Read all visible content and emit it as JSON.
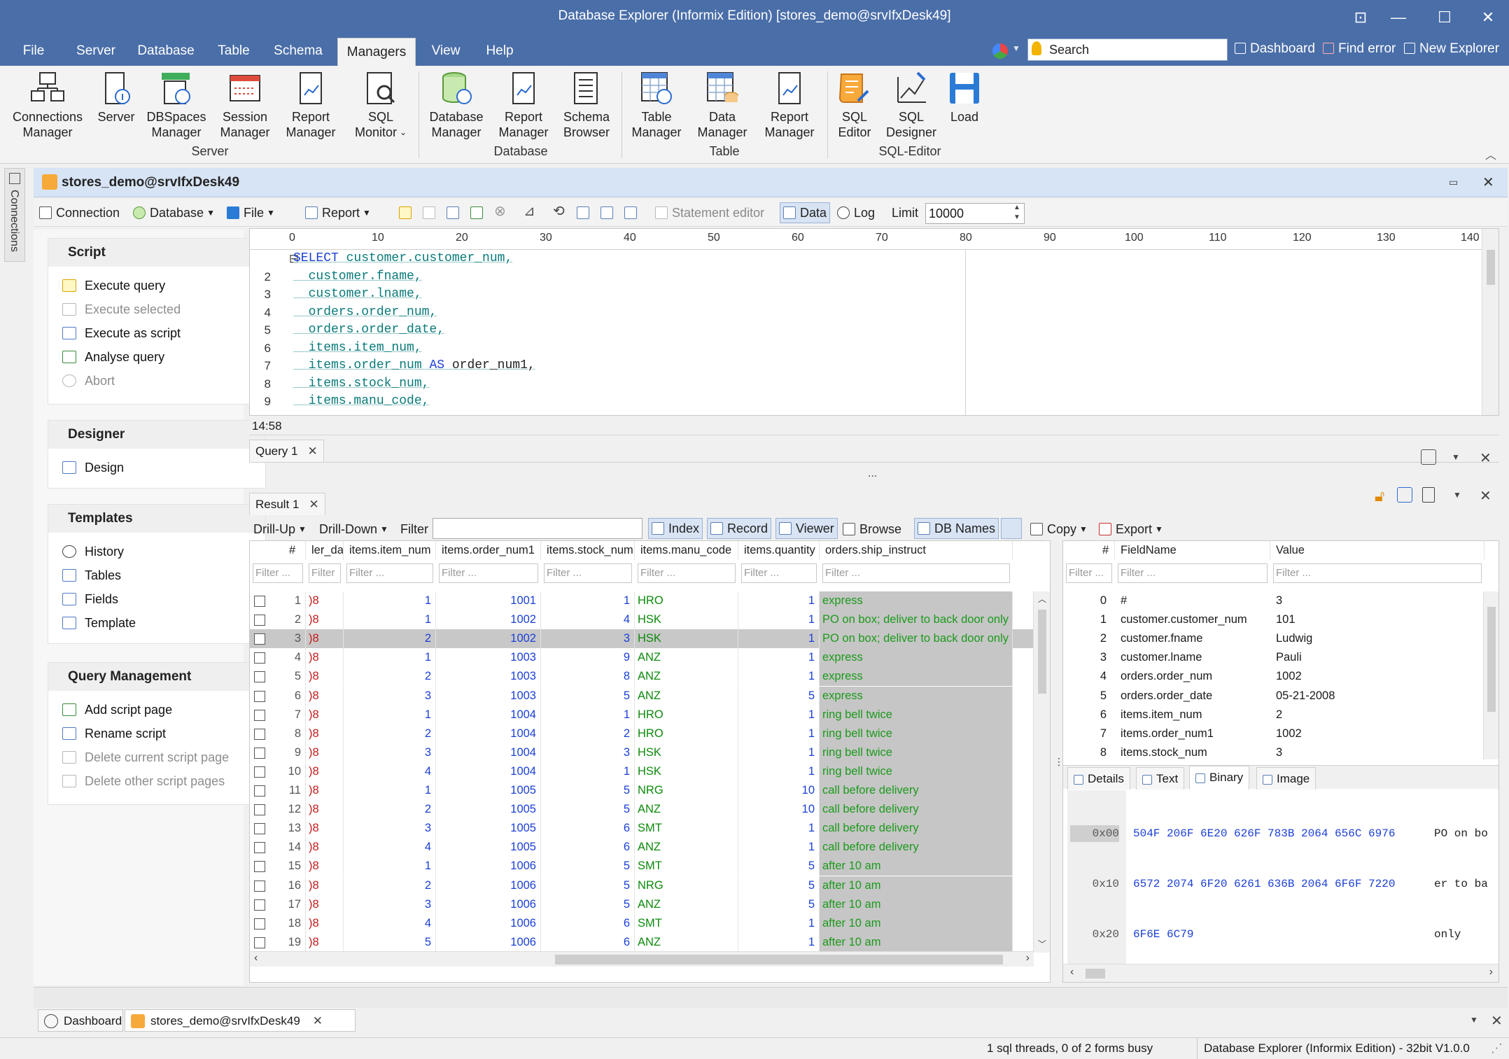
{
  "window": {
    "title": "Database Explorer (Informix Edition) [stores_demo@srvIfxDesk49]",
    "minimize": "—",
    "maximize": "☐",
    "close": "✕",
    "restore": "⊡"
  },
  "menu": {
    "items": [
      "File",
      "Server",
      "Database",
      "Table",
      "Schema",
      "Managers",
      "View",
      "Help"
    ],
    "active": "Managers",
    "search_placeholder": "Search",
    "dashboard": "Dashboard",
    "find_error": "Find error",
    "new_explorer": "New Explorer"
  },
  "ribbon": {
    "server_group": "Server",
    "database_group": "Database",
    "table_group": "Table",
    "sqleditor_group": "SQL-Editor",
    "buttons": [
      {
        "l1": "Connections",
        "l2": "Manager"
      },
      {
        "l1": "Server",
        "l2": ""
      },
      {
        "l1": "DBSpaces",
        "l2": "Manager"
      },
      {
        "l1": "Session",
        "l2": "Manager"
      },
      {
        "l1": "Report",
        "l2": "Manager"
      },
      {
        "l1": "SQL",
        "l2": "Monitor"
      },
      {
        "l1": "Database",
        "l2": "Manager"
      },
      {
        "l1": "Report",
        "l2": "Manager"
      },
      {
        "l1": "Schema",
        "l2": "Browser"
      },
      {
        "l1": "Table",
        "l2": "Manager"
      },
      {
        "l1": "Data",
        "l2": "Manager"
      },
      {
        "l1": "Report",
        "l2": "Manager"
      },
      {
        "l1": "SQL",
        "l2": "Editor"
      },
      {
        "l1": "SQL",
        "l2": "Designer"
      },
      {
        "l1": "Load",
        "l2": ""
      }
    ]
  },
  "side_tab": "Connections",
  "doc": {
    "title": "stores_demo@srvIfxDesk49"
  },
  "toolbar": {
    "connection": "Connection",
    "database": "Database",
    "file": "File",
    "report": "Report",
    "statement_editor": "Statement editor",
    "data": "Data",
    "log": "Log",
    "limit_label": "Limit",
    "limit_value": "10000"
  },
  "left": {
    "script": {
      "title": "Script",
      "items": [
        "Execute query",
        "Execute selected",
        "Execute as script",
        "Analyse query",
        "Abort"
      ]
    },
    "designer": {
      "title": "Designer",
      "items": [
        "Design"
      ]
    },
    "templates": {
      "title": "Templates",
      "items": [
        "History",
        "Tables",
        "Fields",
        "Template"
      ]
    },
    "qm": {
      "title": "Query Management",
      "items": [
        "Add script page",
        "Rename script",
        "Delete current script page",
        "Delete other script pages"
      ]
    }
  },
  "editor": {
    "ruler": [
      "0",
      "10",
      "20",
      "30",
      "40",
      "50",
      "60",
      "70",
      "80",
      "90",
      "100",
      "110",
      "120",
      "130",
      "140"
    ],
    "lines": [
      {
        "n": "",
        "kw": "SELECT",
        "t": " customer.customer_num,"
      },
      {
        "n": "2",
        "kw": "",
        "t": "  customer.fname,"
      },
      {
        "n": "3",
        "kw": "",
        "t": "  customer.lname,"
      },
      {
        "n": "4",
        "kw": "",
        "t": "  orders.order_num,"
      },
      {
        "n": "5",
        "kw": "",
        "t": "  orders.order_date,"
      },
      {
        "n": "6",
        "kw": "",
        "t": "  items.item_num,"
      },
      {
        "n": "7",
        "kw": "AS",
        "t": "  items.order_num ",
        "after": " order_num1,"
      },
      {
        "n": "8",
        "kw": "",
        "t": "  items.stock_num,"
      },
      {
        "n": "9",
        "kw": "",
        "t": "  items.manu_code,"
      }
    ],
    "cursor": "14:58",
    "collapse": "⊟"
  },
  "query_tab": "Query 1",
  "result_tab": "Result 1",
  "ellipsis": "...",
  "resulttoolbar": {
    "drill_up": "Drill-Up",
    "drill_down": "Drill-Down",
    "filter": "Filter",
    "index": "Index",
    "record": "Record",
    "viewer": "Viewer",
    "browse": "Browse",
    "db_names": "DB Names",
    "copy": "Copy",
    "export": "Export"
  },
  "grid": {
    "headers": [
      "#",
      "ler_date",
      "items.item_num",
      "items.order_num1",
      "items.stock_num",
      "items.manu_code",
      "items.quantity",
      "orders.ship_instruct"
    ],
    "filter_placeholder": "Filter ...",
    "rows": [
      [
        "1",
        ")8",
        "1",
        "1001",
        "1",
        "HRO",
        "1",
        "express"
      ],
      [
        "2",
        ")8",
        "1",
        "1002",
        "4",
        "HSK",
        "1",
        "PO on box; deliver to back door only"
      ],
      [
        "3",
        ")8",
        "2",
        "1002",
        "3",
        "HSK",
        "1",
        "PO on box; deliver to back door only"
      ],
      [
        "4",
        ")8",
        "1",
        "1003",
        "9",
        "ANZ",
        "1",
        "express"
      ],
      [
        "5",
        ")8",
        "2",
        "1003",
        "8",
        "ANZ",
        "1",
        "express"
      ],
      [
        "6",
        ")8",
        "3",
        "1003",
        "5",
        "ANZ",
        "5",
        "express"
      ],
      [
        "7",
        ")8",
        "1",
        "1004",
        "1",
        "HRO",
        "1",
        "ring bell twice"
      ],
      [
        "8",
        ")8",
        "2",
        "1004",
        "2",
        "HRO",
        "1",
        "ring bell twice"
      ],
      [
        "9",
        ")8",
        "3",
        "1004",
        "3",
        "HSK",
        "1",
        "ring bell twice"
      ],
      [
        "10",
        ")8",
        "4",
        "1004",
        "1",
        "HSK",
        "1",
        "ring bell twice"
      ],
      [
        "11",
        ")8",
        "1",
        "1005",
        "5",
        "NRG",
        "10",
        "call before delivery"
      ],
      [
        "12",
        ")8",
        "2",
        "1005",
        "5",
        "ANZ",
        "10",
        "call before delivery"
      ],
      [
        "13",
        ")8",
        "3",
        "1005",
        "6",
        "SMT",
        "1",
        "call before delivery"
      ],
      [
        "14",
        ")8",
        "4",
        "1005",
        "6",
        "ANZ",
        "1",
        "call before delivery"
      ],
      [
        "15",
        ")8",
        "1",
        "1006",
        "5",
        "SMT",
        "5",
        "after 10 am"
      ],
      [
        "16",
        ")8",
        "2",
        "1006",
        "5",
        "NRG",
        "5",
        "after 10 am"
      ],
      [
        "17",
        ")8",
        "3",
        "1006",
        "5",
        "ANZ",
        "5",
        "after 10 am"
      ],
      [
        "18",
        ")8",
        "4",
        "1006",
        "6",
        "SMT",
        "1",
        "after 10 am"
      ],
      [
        "19",
        ")8",
        "5",
        "1006",
        "6",
        "ANZ",
        "1",
        "after 10 am"
      ]
    ]
  },
  "record": {
    "headers": [
      "#",
      "FieldName",
      "Value"
    ],
    "rows": [
      [
        "0",
        "#",
        "3"
      ],
      [
        "1",
        "customer.customer_num",
        "101"
      ],
      [
        "2",
        "customer.fname",
        "Ludwig"
      ],
      [
        "3",
        "customer.lname",
        "Pauli"
      ],
      [
        "4",
        "orders.order_num",
        "1002"
      ],
      [
        "5",
        "orders.order_date",
        "05-21-2008"
      ],
      [
        "6",
        "items.item_num",
        "2"
      ],
      [
        "7",
        "items.order_num1",
        "1002"
      ],
      [
        "8",
        "items.stock_num",
        "3"
      ]
    ],
    "tabs": [
      "Details",
      "Text",
      "Binary",
      "Image"
    ],
    "hex": [
      {
        "addr": "0x00",
        "bytes": "504F 206F 6E20 626F 783B 2064 656C 6976",
        "ascii": "PO on bo"
      },
      {
        "addr": "0x10",
        "bytes": "6572 2074 6F20 6261 636B 2064 6F6F 7220",
        "ascii": "er to ba"
      },
      {
        "addr": "0x20",
        "bytes": "6F6E 6C79",
        "ascii": "only"
      }
    ]
  },
  "doctabs": {
    "dashboard": "Dashboard",
    "doc": "stores_demo@srvIfxDesk49"
  },
  "status": {
    "threads": "1 sql threads, 0 of 2 forms busy",
    "app": "Database Explorer (Informix Edition) - 32bit V1.0.0"
  }
}
